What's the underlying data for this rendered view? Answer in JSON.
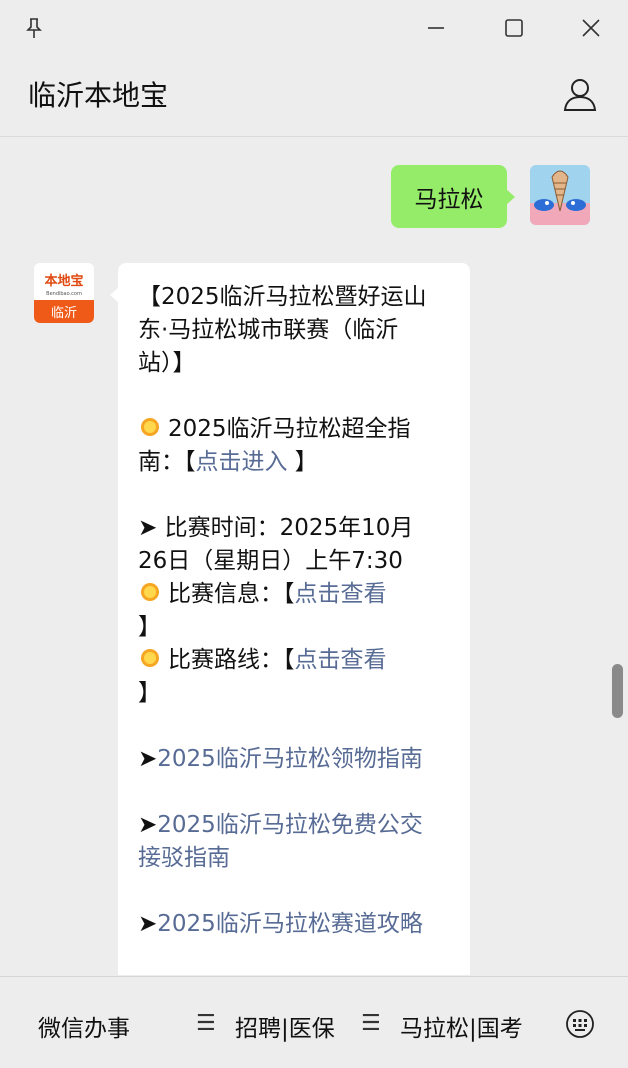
{
  "window": {
    "pin_icon": "pin-icon",
    "minimize_icon": "minimize-icon",
    "maximize_icon": "maximize-icon",
    "close_icon": "close-icon"
  },
  "header": {
    "title": "临沂本地宝",
    "profile_icon": "person-icon"
  },
  "chat": {
    "user_message": "马拉松",
    "bot_avatar": {
      "top_text": "本地宝",
      "small_text": "Bendibao.com",
      "bottom_text": "临沂",
      "bg": "#f05a19"
    },
    "bot_message": {
      "title_1": "【2025临沂马拉松暨好运山",
      "title_2": "东·马拉松城市联赛（临沂",
      "title_3": "站）】",
      "guide_1": "2025临沂马拉松超全指",
      "guide_2_prefix": "南：【",
      "guide_2_link": "点击进入",
      "guide_2_suffix": " 】",
      "time_1": "➤ 比赛时间：2025年10月",
      "time_2": "26日（星期日）上午7:30",
      "info_prefix": "比赛信息：【",
      "info_link": "点击查看",
      "info_suffix": "】",
      "route_prefix": "比赛路线：【",
      "route_link": "点击查看",
      "route_suffix": "】",
      "arrow": "➤",
      "link_kit": "2025临沂马拉松领物指南",
      "link_bus_1": "2025临沂马拉松免费公交",
      "link_bus_2": "接驳指南",
      "link_track": "2025临沂马拉松赛道攻略"
    }
  },
  "bottom_menu": {
    "item_1": "微信办事",
    "sep": "☰",
    "item_2": "招聘|医保",
    "item_3": "马拉松|国考",
    "keyboard_icon": "keyboard-icon"
  },
  "colors": {
    "link": "#576b95",
    "user_bubble": "#95ec69",
    "background": "#ededed"
  }
}
